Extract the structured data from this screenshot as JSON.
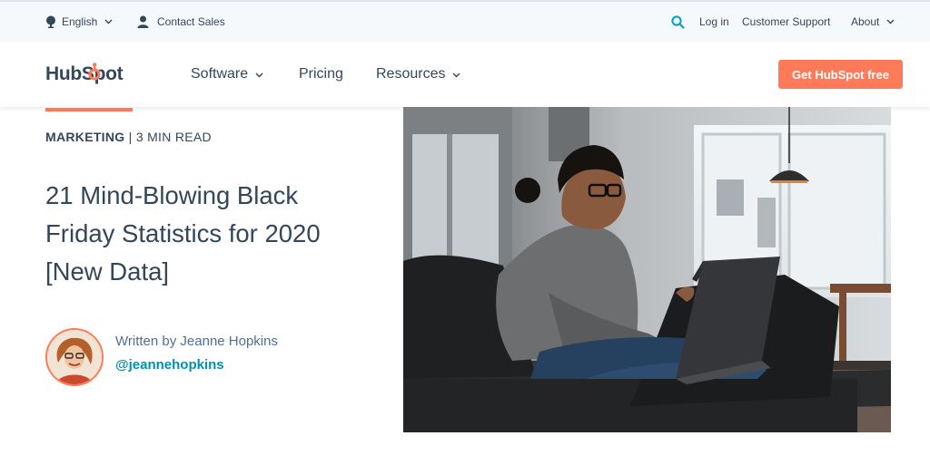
{
  "utility": {
    "language_label": "English",
    "contact_sales_label": "Contact Sales",
    "login_label": "Log in",
    "support_label": "Customer Support",
    "about_label": "About"
  },
  "nav": {
    "logo_text": "HubSpot",
    "software_label": "Software",
    "pricing_label": "Pricing",
    "resources_label": "Resources",
    "cta_label": "Get HubSpot free"
  },
  "article": {
    "category": "MARKETING",
    "separator": " | ",
    "read_time": "3 MIN READ",
    "title": "21 Mind-Blowing Black Friday Statistics for 2020 [New Data]",
    "author_prefix": "Written by Jeanne Hopkins",
    "author_handle": "@jeannehopkins"
  },
  "colors": {
    "brand_orange": "#ff7a59",
    "text_dark": "#33475b",
    "link_teal": "#0091ae",
    "utility_bg": "#f6f9fc"
  },
  "icons": [
    "globe-icon",
    "person-icon",
    "search-icon",
    "chevron-down-icon",
    "sprocket-icon"
  ]
}
